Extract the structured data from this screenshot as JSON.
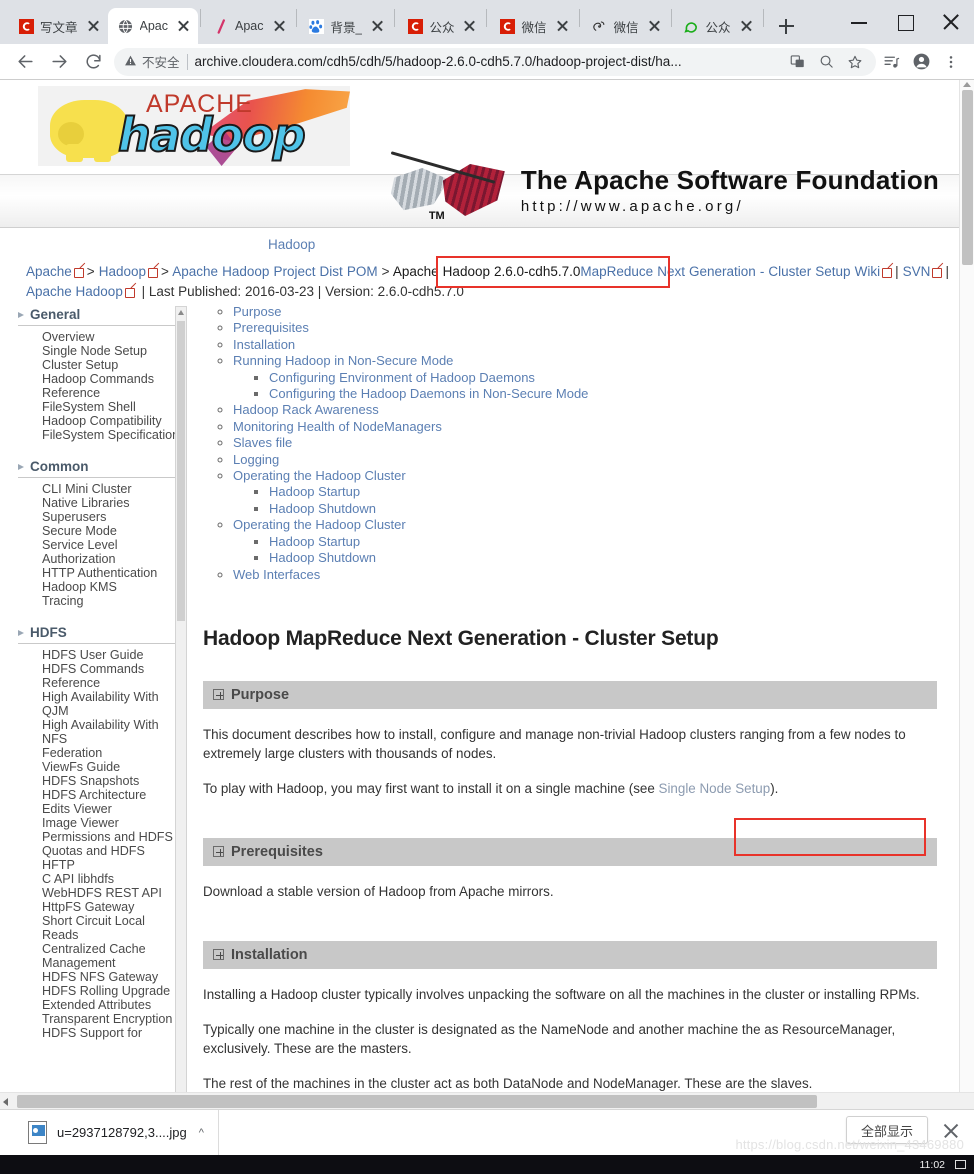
{
  "browser": {
    "tabs": [
      {
        "title": "写文章",
        "favicon": "csdn-icon",
        "active": false
      },
      {
        "title": "Apac",
        "favicon": "globe-icon",
        "active": true
      },
      {
        "title": "Apac",
        "favicon": "slash-icon",
        "active": false
      },
      {
        "title": "背景_",
        "favicon": "baidu-icon",
        "active": false
      },
      {
        "title": "公众",
        "favicon": "csdn-icon",
        "active": false
      },
      {
        "title": "微信",
        "favicon": "csdn-icon",
        "active": false
      },
      {
        "title": "微信",
        "favicon": "sogou-icon",
        "active": false
      },
      {
        "title": "公众",
        "favicon": "wechat-icon",
        "active": false
      }
    ],
    "new_tab_label": "+",
    "window_controls": {
      "minimize": "minimize-icon",
      "maximize": "maximize-icon",
      "close": "close-icon"
    },
    "toolbar": {
      "back": "back-arrow-icon",
      "forward": "forward-arrow-icon",
      "reload": "reload-icon",
      "security_label": "不安全",
      "url": "archive.cloudera.com/cdh5/cdh/5/hadoop-2.6.0-cdh5.7.0/hadoop-project-dist/ha...",
      "translate": "translate-icon",
      "zoom": "zoom-out-icon",
      "bookmark": "star-icon",
      "media": "media-list-icon",
      "profile": "profile-icon",
      "menu": "kebab-menu-icon"
    }
  },
  "logo": {
    "apache_word": "APACHE",
    "hadoop_word": "hadoop"
  },
  "asf": {
    "title": "The Apache Software Foundation",
    "url": "http://www.apache.org/",
    "tm": "TM"
  },
  "hadoop_link": "Hadoop",
  "breadcrumb": {
    "items": [
      "Apache",
      "Hadoop",
      "Apache Hadoop Project Dist POM",
      "Apache Hadoop 2.6.0-cdh5.7.0"
    ],
    "separator": ">",
    "tail": "MapReduce Next Generation - Cluster Setup",
    "wiki": "Wiki",
    "svn": "SVN",
    "apache_hadoop": "Apache Hadoop",
    "last_published_label": "Last Published:",
    "last_published": "2016-03-23",
    "version_label": "Version:",
    "version": "2.6.0-cdh5.7.0",
    "pipe": "|"
  },
  "sidebar": {
    "groups": [
      {
        "title": "General",
        "items": [
          "Overview",
          "Single Node Setup",
          "Cluster Setup",
          "Hadoop Commands Reference",
          "FileSystem Shell",
          "Hadoop Compatibility",
          "FileSystem Specification"
        ]
      },
      {
        "title": "Common",
        "items": [
          "CLI Mini Cluster",
          "Native Libraries",
          "Superusers",
          "Secure Mode",
          "Service Level Authorization",
          "HTTP Authentication",
          "Hadoop KMS",
          "Tracing"
        ]
      },
      {
        "title": "HDFS",
        "items": [
          "HDFS User Guide",
          "HDFS Commands Reference",
          "High Availability With QJM",
          "High Availability With NFS",
          "Federation",
          "ViewFs Guide",
          "HDFS Snapshots",
          "HDFS Architecture",
          "Edits Viewer",
          "Image Viewer",
          "Permissions and HDFS",
          "Quotas and HDFS",
          "HFTP",
          "C API libhdfs",
          "WebHDFS REST API",
          "HttpFS Gateway",
          "Short Circuit Local Reads",
          "Centralized Cache Management",
          "HDFS NFS Gateway",
          "HDFS Rolling Upgrade",
          "Extended Attributes",
          "Transparent Encryption",
          "HDFS Support for"
        ]
      }
    ]
  },
  "toc": [
    {
      "label": "Purpose",
      "children": []
    },
    {
      "label": "Prerequisites",
      "children": []
    },
    {
      "label": "Installation",
      "children": []
    },
    {
      "label": "Running Hadoop in Non-Secure Mode",
      "children": [
        "Configuring Environment of Hadoop Daemons",
        "Configuring the Hadoop Daemons in Non-Secure Mode"
      ]
    },
    {
      "label": "Hadoop Rack Awareness",
      "children": []
    },
    {
      "label": "Monitoring Health of NodeManagers",
      "children": []
    },
    {
      "label": "Slaves file",
      "children": []
    },
    {
      "label": "Logging",
      "children": []
    },
    {
      "label": "Operating the Hadoop Cluster",
      "children": [
        "Hadoop Startup",
        "Hadoop Shutdown"
      ]
    },
    {
      "label": "Operating the Hadoop Cluster",
      "children": [
        "Hadoop Startup",
        "Hadoop Shutdown"
      ]
    },
    {
      "label": "Web Interfaces",
      "children": []
    }
  ],
  "doc": {
    "title": "Hadoop MapReduce Next Generation - Cluster Setup",
    "sections": [
      {
        "heading": "Purpose",
        "paragraphs": [
          {
            "text": "This document describes how to install, configure and manage non-trivial Hadoop clusters ranging from a few nodes to extremely large clusters with thousands of nodes."
          },
          {
            "prefix": "To play with Hadoop, you may first want to install it on a single machine (see ",
            "link": "Single Node Setup",
            "suffix": ")."
          }
        ]
      },
      {
        "heading": "Prerequisites",
        "paragraphs": [
          {
            "text": "Download a stable version of Hadoop from Apache mirrors."
          }
        ]
      },
      {
        "heading": "Installation",
        "paragraphs": [
          {
            "text": "Installing a Hadoop cluster typically involves unpacking the software on all the machines in the cluster or installing RPMs."
          },
          {
            "text": "Typically one machine in the cluster is designated as the NameNode and another machine the as ResourceManager, exclusively. These are the masters."
          },
          {
            "text": "The rest of the machines in the cluster act as both DataNode and NodeManager. These are the slaves."
          }
        ]
      }
    ]
  },
  "downloads": {
    "file_name": "u=2937128792,3....jpg",
    "caret": "^",
    "show_all": "全部显示",
    "close": "close-icon"
  },
  "watermark": "https://blog.csdn.net/weixin_43469880",
  "taskbar": {
    "time": "11:02"
  },
  "colors": {
    "accent_red": "#e8332a",
    "link_blue": "#5b7fb3",
    "breadcrumb_blue": "#4a71a8",
    "section_grey": "#c8c8c8",
    "chrome_grey": "#dee1e6"
  }
}
